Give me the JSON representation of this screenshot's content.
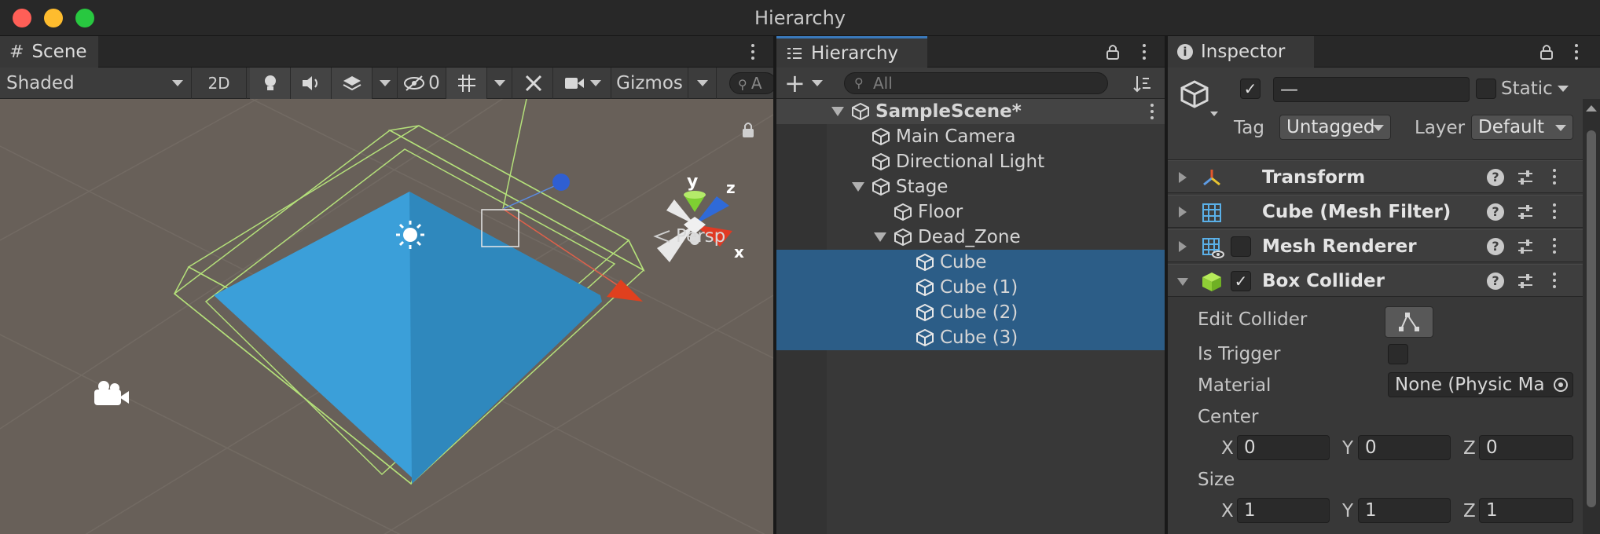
{
  "window": {
    "title": "Hierarchy"
  },
  "scene": {
    "tab_label": "Scene",
    "shading_mode": "Shaded",
    "mode_2d": "2D",
    "hidden_count": "0",
    "gizmos_label": "Gizmos",
    "search_placeholder": "A",
    "persp_label": "Persp",
    "axis_y": "y",
    "axis_z": "z",
    "axis_x": "x",
    "colors": {
      "floor": "#3b9fd9",
      "background": "#686059",
      "wire": "#b4e07a"
    }
  },
  "hierarchy": {
    "tab_label": "Hierarchy",
    "search_placeholder": "All",
    "items": [
      {
        "label": "SampleScene*"
      },
      {
        "label": "Main Camera"
      },
      {
        "label": "Directional Light"
      },
      {
        "label": "Stage"
      },
      {
        "label": "Floor"
      },
      {
        "label": "Dead_Zone"
      },
      {
        "label": "Cube"
      },
      {
        "label": "Cube (1)"
      },
      {
        "label": "Cube (2)"
      },
      {
        "label": "Cube (3)"
      }
    ]
  },
  "inspector": {
    "tab_label": "Inspector",
    "object_name": "—",
    "static_label": "Static",
    "tag_label": "Tag",
    "tag_value": "Untagged",
    "layer_label": "Layer",
    "layer_value": "Default",
    "components": [
      {
        "title": "Transform"
      },
      {
        "title": "Cube (Mesh Filter)"
      },
      {
        "title": "Mesh Renderer"
      },
      {
        "title": "Box Collider"
      }
    ],
    "help_glyph": "?",
    "box_collider": {
      "edit_collider_label": "Edit Collider",
      "is_trigger_label": "Is Trigger",
      "material_label": "Material",
      "material_value": "None (Physic Ma",
      "center_label": "Center",
      "size_label": "Size",
      "axis_x": "X",
      "axis_y": "Y",
      "axis_z": "Z",
      "center": {
        "x": "0",
        "y": "0",
        "z": "0"
      },
      "size": {
        "x": "1",
        "y": "1",
        "z": "1"
      }
    }
  }
}
